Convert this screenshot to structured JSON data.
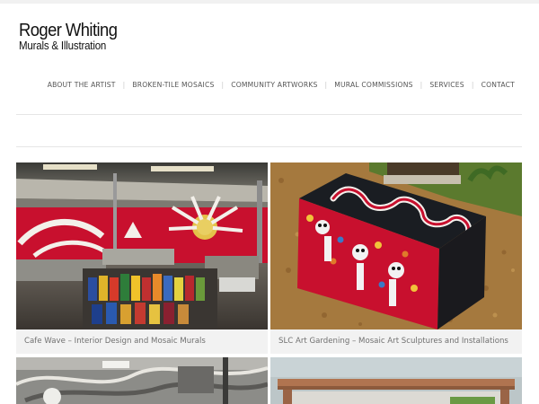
{
  "site": {
    "title": "Roger Whiting",
    "subtitle": "Murals & Illustration"
  },
  "nav": {
    "items": [
      {
        "label": "ABOUT THE ARTIST"
      },
      {
        "label": "BROKEN-TILE MOSAICS"
      },
      {
        "label": "COMMUNITY ARTWORKS"
      },
      {
        "label": "MURAL COMMISSIONS"
      },
      {
        "label": "SERVICES"
      },
      {
        "label": "CONTACT"
      }
    ]
  },
  "gallery": {
    "items": [
      {
        "caption": "Cafe Wave – Interior Design and Mosaic Murals"
      },
      {
        "caption": "SLC Art Gardening – Mosaic Art Sculptures and Installations"
      },
      {
        "caption": ""
      },
      {
        "caption": ""
      }
    ]
  },
  "colors": {
    "text_dark": "#111111",
    "nav_text": "#555555",
    "caption_bg": "#f2f2f2",
    "caption_text": "#707070",
    "mural_red": "#c8102e"
  }
}
